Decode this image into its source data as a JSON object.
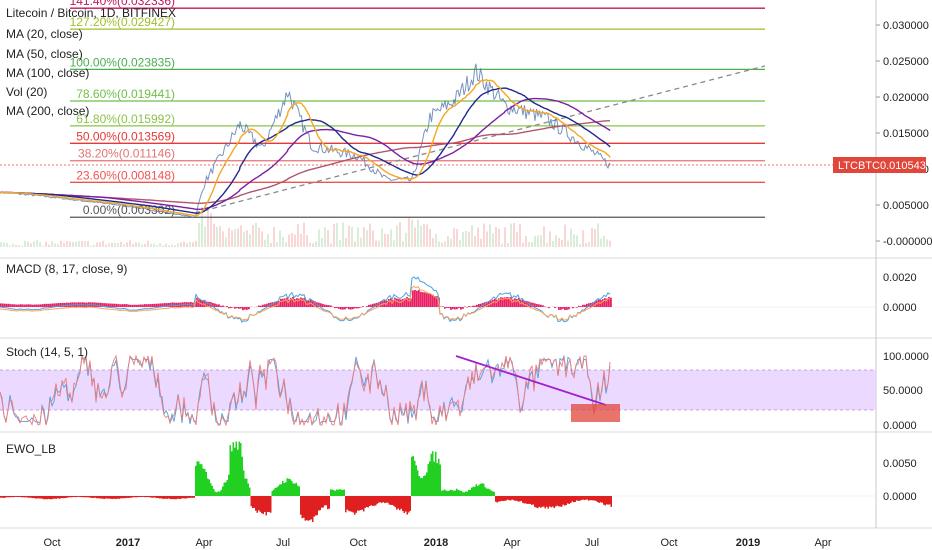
{
  "chart_data": {
    "type": "line",
    "symbol_title": "Litecoin / Bitcoin, 1D, BITFINEX",
    "main_indicators": [
      "MA (20, close)",
      "MA (50, close)",
      "MA (100, close)",
      "Vol (20)",
      "MA (200, close)"
    ],
    "price_tag": {
      "symbol": "LTCBTC",
      "value": "0.010543"
    },
    "main_y_ticks": [
      "0.030000",
      "0.025000",
      "0.020000",
      "0.015000",
      "0.010000",
      "0.005000",
      "-0.000000"
    ],
    "fib_levels": [
      {
        "label": "141.40%(0.032336)",
        "value": 0.032336,
        "color": "#c2185b"
      },
      {
        "label": "127.20%(0.029427)",
        "value": 0.029427,
        "color": "#9fbf2c"
      },
      {
        "label": "100.00%(0.023835)",
        "value": 0.023835,
        "color": "#4caf50"
      },
      {
        "label": "78.60%(0.019441)",
        "value": 0.019441,
        "color": "#6fbf4a"
      },
      {
        "label": "61.80%(0.015992)",
        "value": 0.015992,
        "color": "#8bc34a"
      },
      {
        "label": "50.00%(0.013569)",
        "value": 0.013569,
        "color": "#e53935"
      },
      {
        "label": "38.20%(0.011146)",
        "value": 0.011146,
        "color": "#e57373"
      },
      {
        "label": "23.60%(0.008148)",
        "value": 0.008148,
        "color": "#ef5350"
      },
      {
        "label": "0.00%(0.003302)",
        "value": 0.003302,
        "color": "#555555"
      }
    ],
    "time_ticks": [
      "Oct",
      "2017",
      "Apr",
      "Jul",
      "Oct",
      "2018",
      "Apr",
      "Jul",
      "Oct",
      "2019",
      "Apr"
    ],
    "approx_price_series": {
      "x": [
        "2016-08",
        "2016-10",
        "2017-01",
        "2017-03",
        "2017-04",
        "2017-05",
        "2017-06",
        "2017-07",
        "2017-08",
        "2017-10",
        "2017-11",
        "2017-12",
        "2018-01",
        "2018-02",
        "2018-03",
        "2018-04",
        "2018-05",
        "2018-06",
        "2018-07"
      ],
      "y": [
        0.0068,
        0.0062,
        0.0049,
        0.0033,
        0.0082,
        0.0162,
        0.0128,
        0.0207,
        0.0132,
        0.0118,
        0.0086,
        0.0084,
        0.0172,
        0.0196,
        0.0235,
        0.0188,
        0.0171,
        0.0142,
        0.0105
      ]
    },
    "macd": {
      "label": "MACD (8, 17, close, 9)",
      "y_ticks": [
        "0.0020",
        "0.0000"
      ]
    },
    "stoch": {
      "label": "Stoch (14, 5, 1)",
      "y_ticks": [
        "100.0000",
        "50.0000",
        "0.0000"
      ]
    },
    "ewo": {
      "label": "EWO_LB",
      "y_ticks": [
        "0.0050",
        "0.0000"
      ]
    },
    "colors": {
      "ma20": "#f5a623",
      "ma50": "#1e2a8a",
      "ma100": "#7b1fa2",
      "ma200": "#b0566e",
      "price": "#4a6fa5",
      "macd_line": "#4aa3df",
      "signal_line": "#f6a55c",
      "macd_hist": "#e91e63",
      "stoch_band": "#e8d2ff",
      "ewo_pos": "#22d022",
      "ewo_neg": "#e02020",
      "trendline": "#888888",
      "stoch_trend": "#a020d0",
      "price_tag_bg": "#e0463a"
    }
  }
}
